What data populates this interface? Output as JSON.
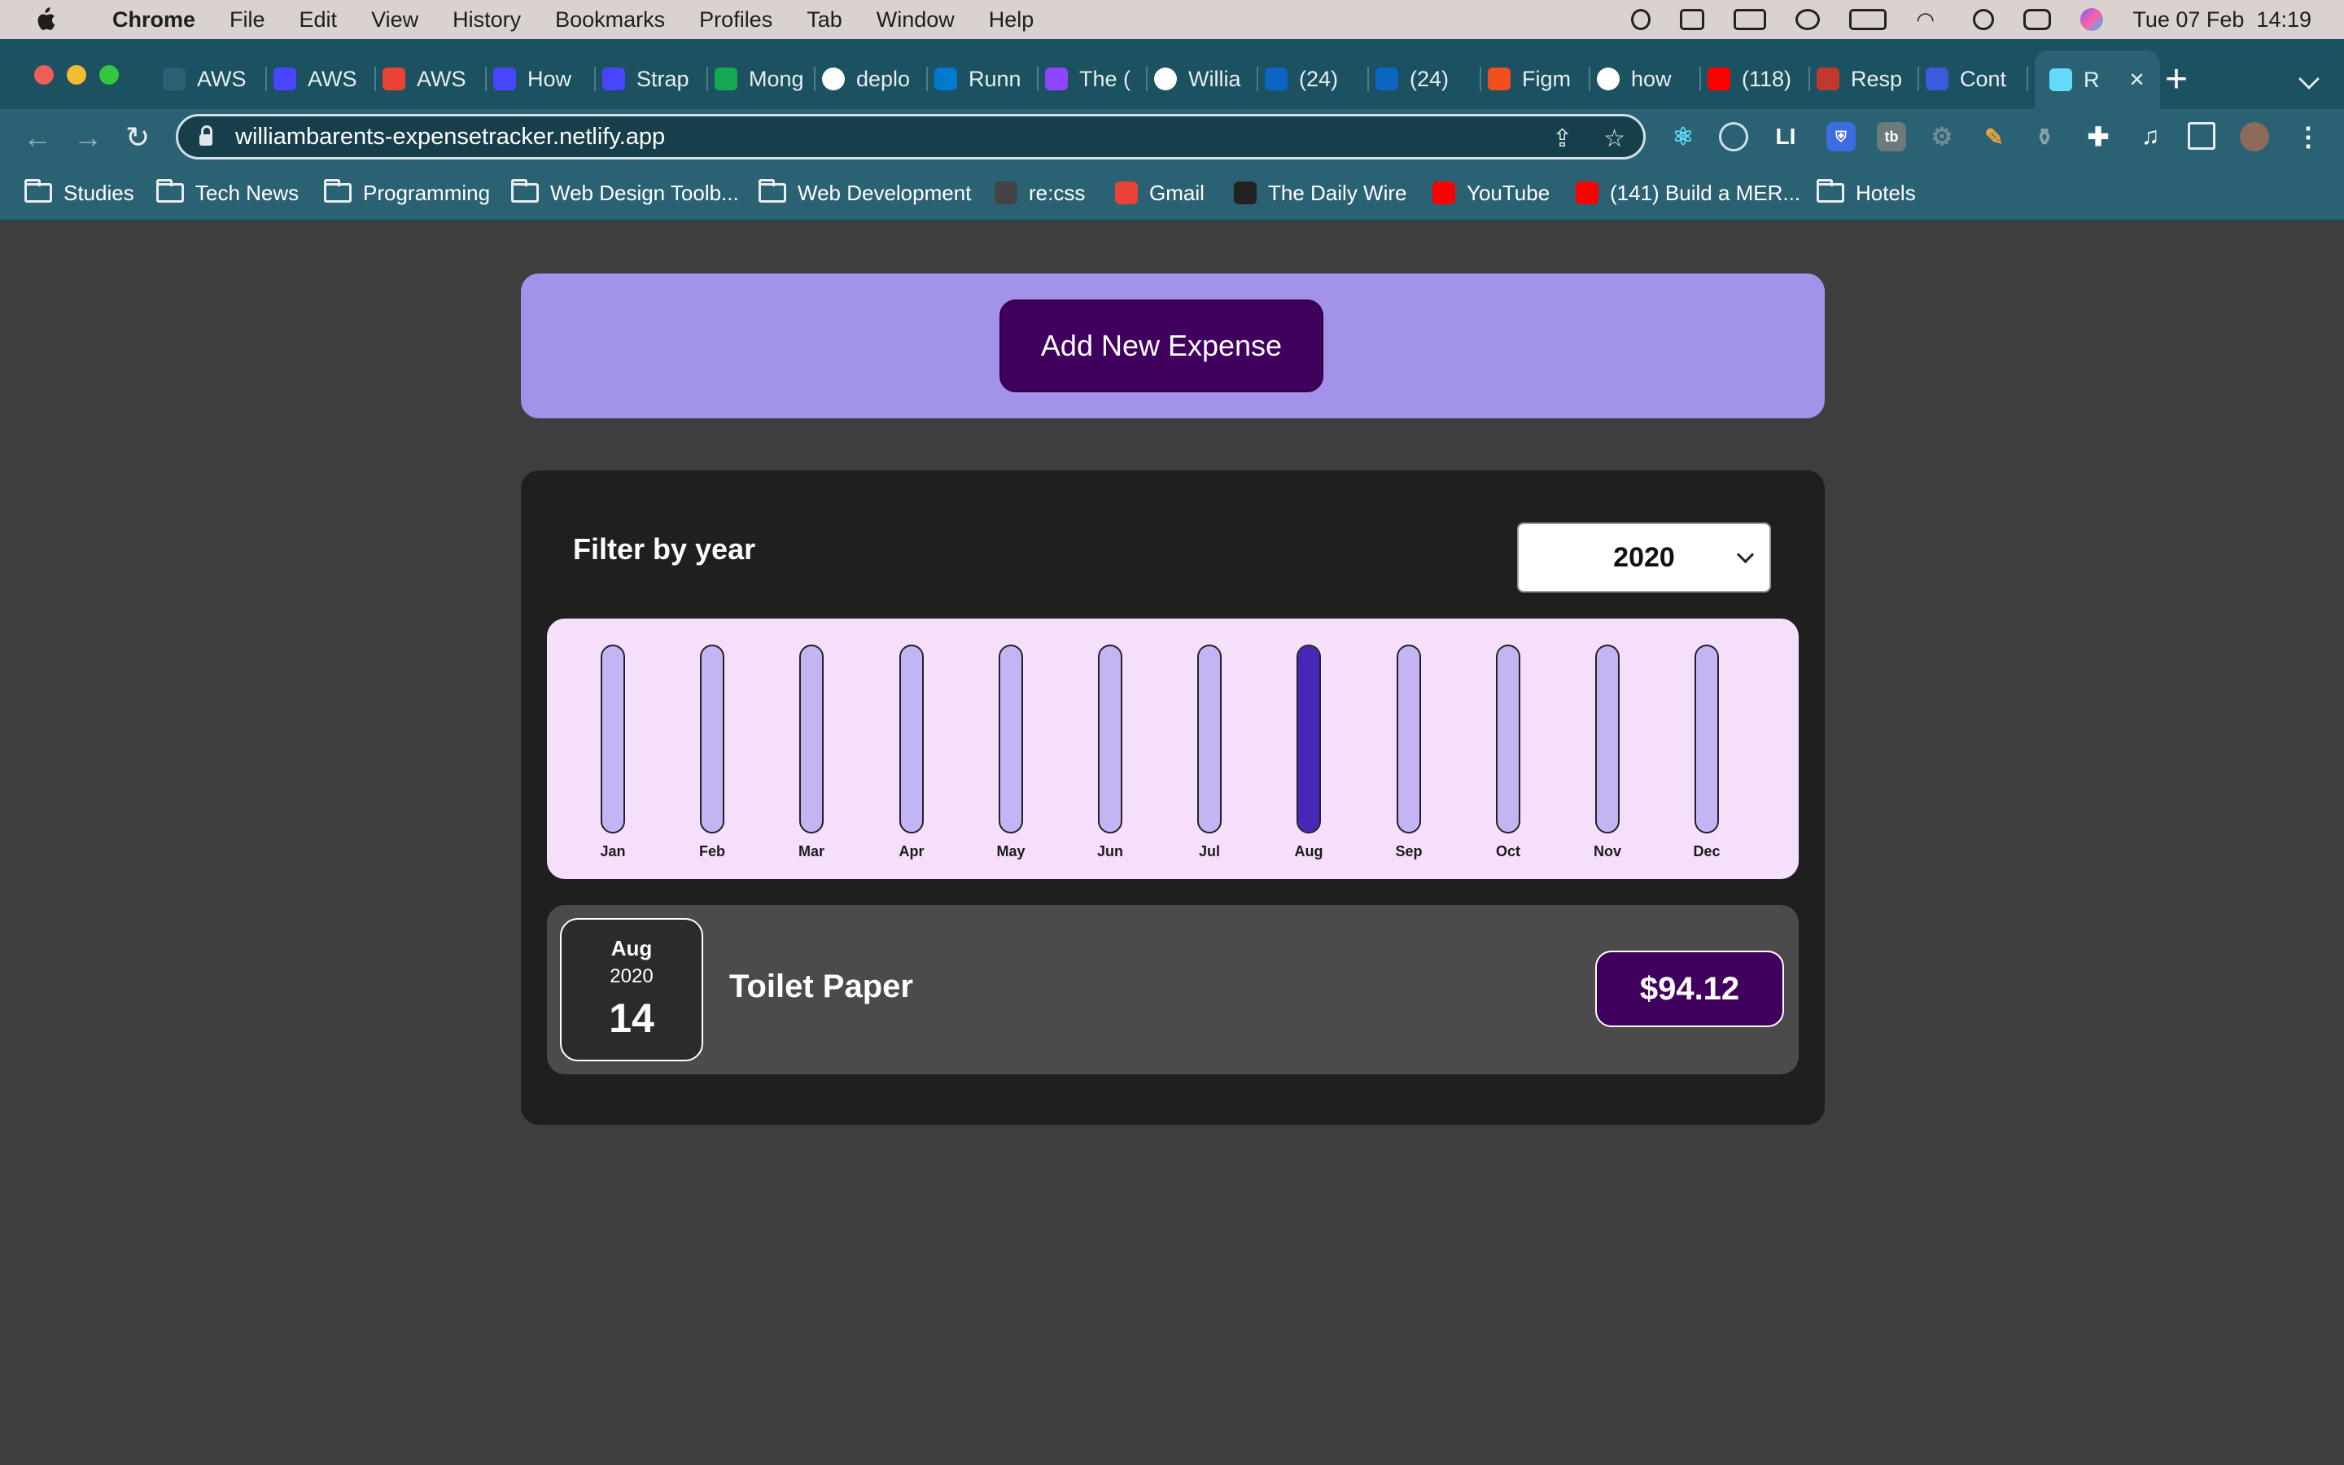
{
  "menubar": {
    "app_name": "Chrome",
    "items": [
      "File",
      "Edit",
      "View",
      "History",
      "Bookmarks",
      "Profiles",
      "Tab",
      "Window",
      "Help"
    ],
    "clock": "Tue 07 Feb  14:19"
  },
  "tabs": [
    {
      "label": "AWS",
      "icon": "globe-icon",
      "color": "#2a6273"
    },
    {
      "label": "AWS",
      "icon": "strapi-icon",
      "color": "#4945ff"
    },
    {
      "label": "AWS",
      "icon": "gmail-icon",
      "color": "#ea4335"
    },
    {
      "label": "How",
      "icon": "strapi-icon",
      "color": "#4945ff"
    },
    {
      "label": "Strap",
      "icon": "strapi-icon",
      "color": "#4945ff"
    },
    {
      "label": "Mong",
      "icon": "mongodb-icon",
      "color": "#13aa52"
    },
    {
      "label": "deplo",
      "icon": "google-icon",
      "color": "#ffffff"
    },
    {
      "label": "Runn",
      "icon": "vscode-icon",
      "color": "#007acc"
    },
    {
      "label": "The (",
      "icon": "shield-icon",
      "color": "#8f44ff"
    },
    {
      "label": "Willia",
      "icon": "github-icon",
      "color": "#ffffff"
    },
    {
      "label": "(24)",
      "icon": "linkedin-icon",
      "color": "#0a66c2"
    },
    {
      "label": "(24)",
      "icon": "linkedin-icon",
      "color": "#0a66c2"
    },
    {
      "label": "Figm",
      "icon": "figma-icon",
      "color": "#f24e1e"
    },
    {
      "label": "how",
      "icon": "google-icon",
      "color": "#ffffff"
    },
    {
      "label": "(118)",
      "icon": "youtube-icon",
      "color": "#ff0000"
    },
    {
      "label": "Resp",
      "icon": "resp-icon",
      "color": "#c0392b"
    },
    {
      "label": "Cont",
      "icon": "m-icon",
      "color": "#3b5bdb"
    },
    {
      "label": "R",
      "icon": "react-icon",
      "color": "#61dafb"
    }
  ],
  "address_bar": {
    "url": "williambarents-expensetracker.netlify.app"
  },
  "bookmarks": [
    {
      "label": "Studies",
      "type": "folder"
    },
    {
      "label": "Tech News",
      "type": "folder"
    },
    {
      "label": "Programming",
      "type": "folder"
    },
    {
      "label": "Web Design Toolb...",
      "type": "folder"
    },
    {
      "label": "Web Development",
      "type": "folder"
    },
    {
      "label": "re:css",
      "type": "site",
      "color": "#444444"
    },
    {
      "label": "Gmail",
      "type": "site",
      "color": "#ea4335"
    },
    {
      "label": "The Daily Wire",
      "type": "site",
      "color": "#222222"
    },
    {
      "label": "YouTube",
      "type": "site",
      "color": "#ff0000"
    },
    {
      "label": "(141) Build a MER...",
      "type": "site",
      "color": "#ff0000"
    },
    {
      "label": "Hotels",
      "type": "folder"
    }
  ],
  "page": {
    "add_button_label": "Add New Expense",
    "filter_label": "Filter by year",
    "selected_year": "2020",
    "chart_data": {
      "type": "bar",
      "categories": [
        "Jan",
        "Feb",
        "Mar",
        "Apr",
        "May",
        "Jun",
        "Jul",
        "Aug",
        "Sep",
        "Oct",
        "Nov",
        "Dec"
      ],
      "values": [
        0,
        0,
        0,
        0,
        0,
        0,
        0,
        94.12,
        0,
        0,
        0,
        0
      ],
      "ylim": [
        0,
        94.12
      ]
    },
    "expenses": [
      {
        "month": "Aug",
        "year": "2020",
        "day": "14",
        "title": "Toilet Paper",
        "amount": "$94.12"
      }
    ]
  },
  "colors": {
    "accent": "#40005d",
    "panel": "#a292ea",
    "chart_bg": "#f6dffa",
    "bar_empty": "#c3b4f3",
    "bar_fill": "#4826b8"
  }
}
